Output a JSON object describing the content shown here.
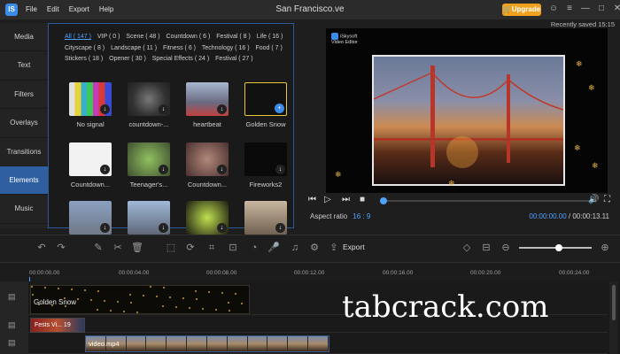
{
  "titlebar": {
    "logo": "IS",
    "menu": [
      "File",
      "Edit",
      "Export",
      "Help"
    ],
    "title": "San Francisco.ve",
    "upgrade": "Upgrade"
  },
  "sidebar": {
    "tabs": [
      "Media",
      "Text",
      "Filters",
      "Overlays",
      "Transitions",
      "Elements",
      "Music"
    ],
    "active": "Elements"
  },
  "library": {
    "filters": [
      "All ( 147 )",
      "VIP ( 0 )",
      "Scene ( 48 )",
      "Countdown ( 6 )",
      "Festival ( 8 )",
      "Life ( 16 )",
      "Cityscape ( 8 )",
      "Landscape ( 11 )",
      "Fitness ( 6 )",
      "Technology ( 16 )",
      "Food ( 7 )",
      "Stickers ( 18 )",
      "Opener ( 30 )",
      "Special Effects ( 24 )",
      "Festival ( 27 )"
    ],
    "items": [
      {
        "label": "No signal"
      },
      {
        "label": "countdown-..."
      },
      {
        "label": "heartbeat"
      },
      {
        "label": "Golden Snow"
      },
      {
        "label": "Countdown..."
      },
      {
        "label": "Teenager's..."
      },
      {
        "label": "Countdown..."
      },
      {
        "label": "Fireworks2"
      },
      {
        "label": ""
      },
      {
        "label": ""
      },
      {
        "label": ""
      },
      {
        "label": ""
      }
    ]
  },
  "preview": {
    "saved": "Recently saved 15:15",
    "watermark_line1": "iSkysoft",
    "watermark_line2": "Video Editor",
    "aspect_label": "Aspect ratio",
    "aspect_value": "16 : 9",
    "time_current": "00:00:00.00",
    "time_total": "/ 00:00:13.11",
    "progress": 0
  },
  "toolbar": {
    "export": "Export",
    "zoom": 0.55
  },
  "timeline": {
    "ticks": [
      "00:00:00.00",
      "00:00:04.00",
      "00:00:08.00",
      "00:00:12.00",
      "00:00:16.00",
      "00:00:20.00",
      "00:00:24.00"
    ],
    "clips": {
      "golden": "Golden Snow",
      "small": "Fests Vi... 19",
      "video": "video.mp4"
    }
  },
  "overlay_text": "tabcrack.com",
  "colors": {
    "accent": "#4ea3ff",
    "upgrade": "#f0a11d",
    "active_tab": "#2f5fa0"
  }
}
